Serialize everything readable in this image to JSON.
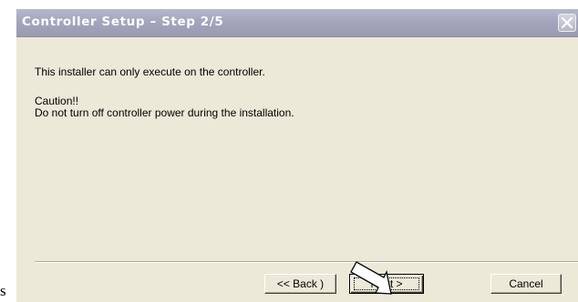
{
  "page": {
    "stray_char": "s"
  },
  "window": {
    "title": "Controller Setup – Step 2/5"
  },
  "message": {
    "line1": "This installer can only execute on the controller.",
    "line2": "Caution!!",
    "line3": "Do not turn off controller power during the installation."
  },
  "buttons": {
    "back_label": "<< Back )",
    "next_label": "Next >",
    "cancel_label": "Cancel"
  },
  "colors": {
    "title_bar": "#a3a6bc",
    "dialog_face": "#ece9d8",
    "title_text": "#ffffff"
  },
  "icons": {
    "close": "close-icon",
    "cursor": "mouse-pointer-icon"
  }
}
